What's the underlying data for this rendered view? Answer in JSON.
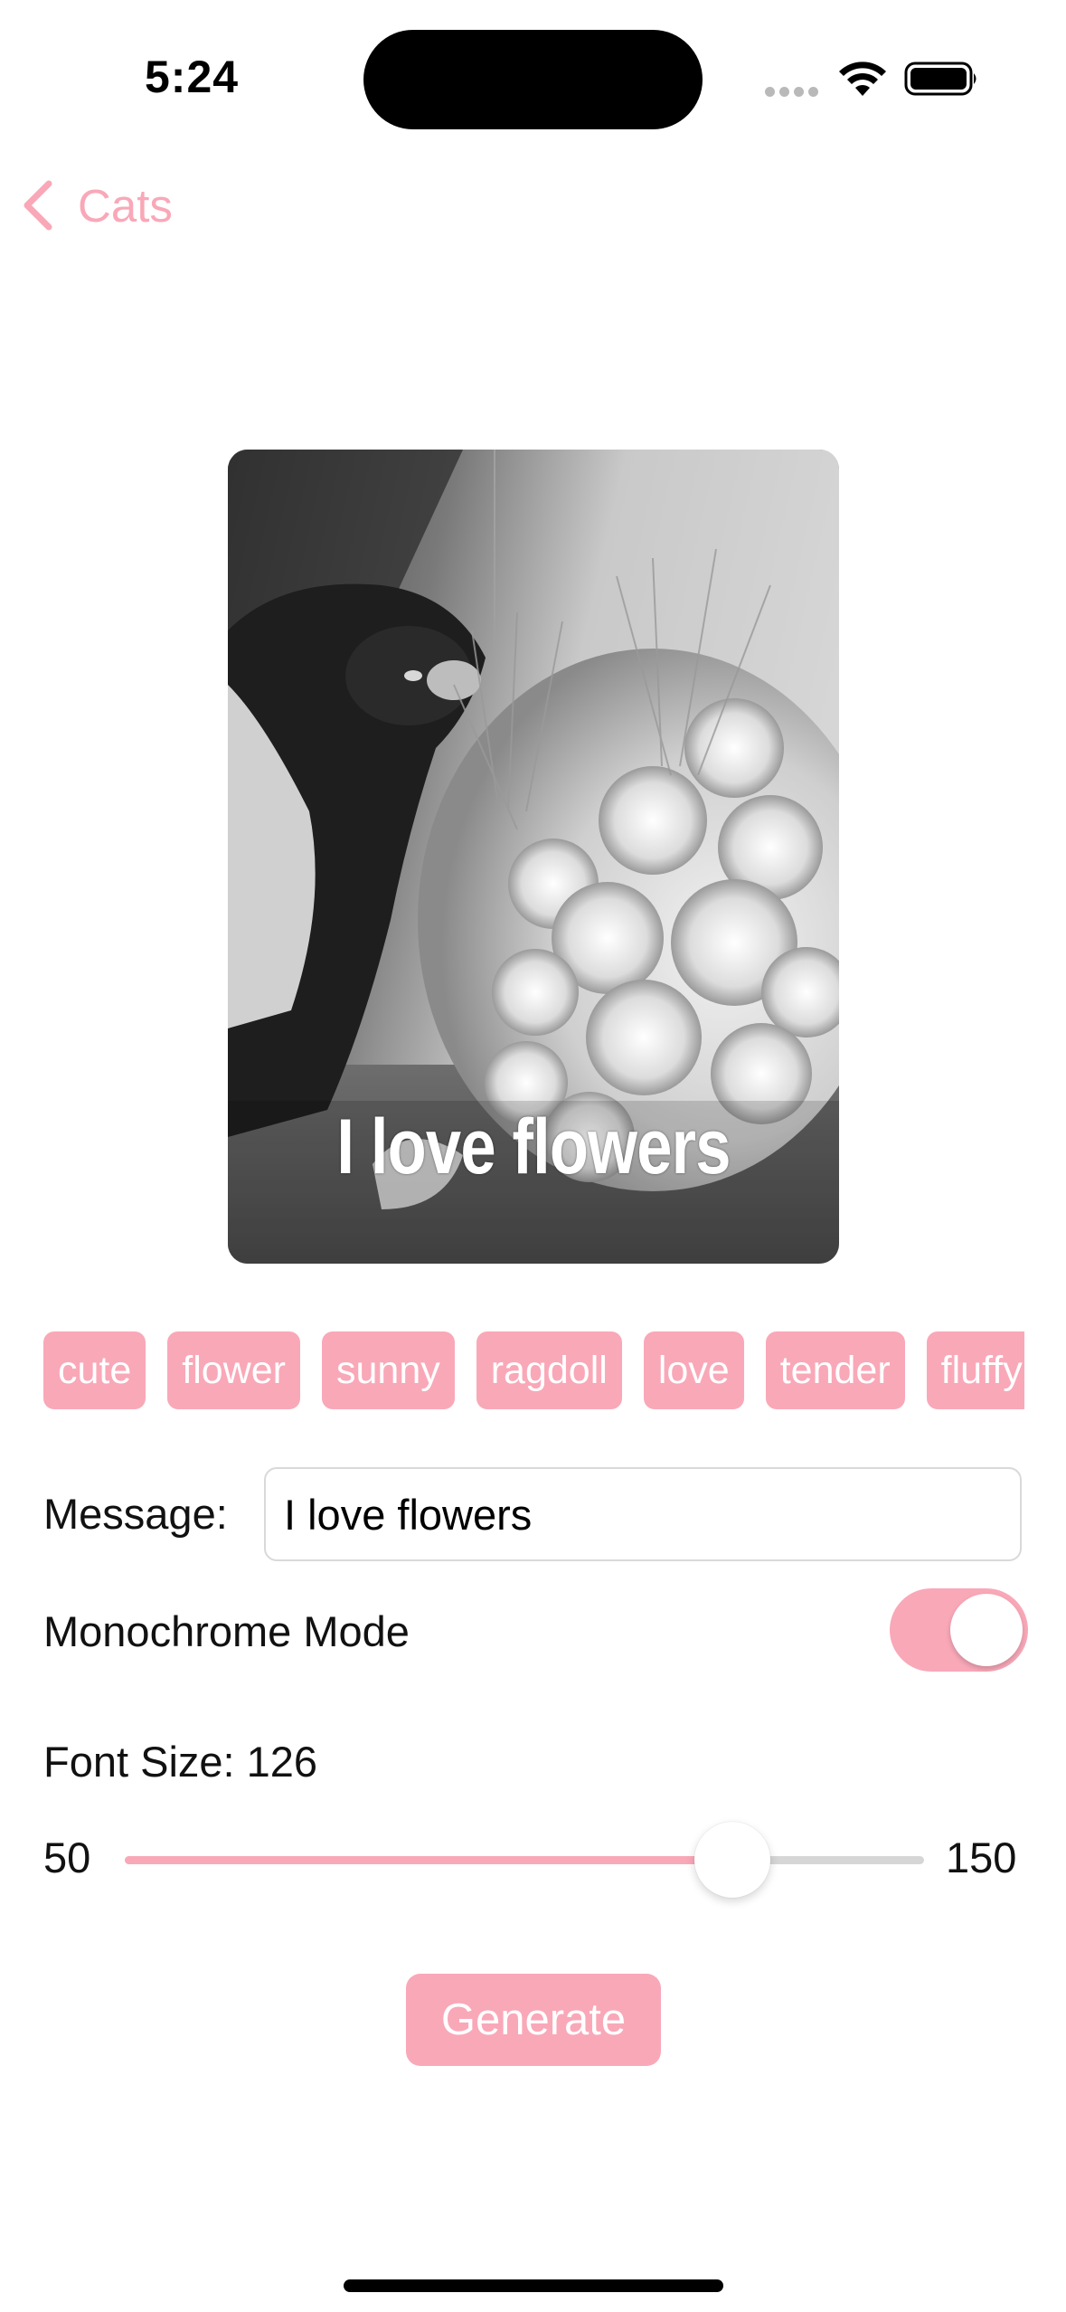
{
  "status_bar": {
    "time": "5:24",
    "icons": [
      "cellular-signal-icon",
      "wifi-icon",
      "battery-icon"
    ]
  },
  "nav": {
    "back_label": "Cats",
    "back_icon": "chevron-left-icon"
  },
  "meme": {
    "caption": "I love flowers",
    "monochrome": true
  },
  "tags": [
    "cute",
    "flower",
    "sunny",
    "ragdoll",
    "love",
    "tender",
    "fluffy"
  ],
  "form": {
    "message_label": "Message:",
    "message_value": "I love flowers",
    "monochrome_label": "Monochrome Mode",
    "monochrome_on": true,
    "font_size_label": "Font Size: 126",
    "font_size_value": 126,
    "slider_min": "50",
    "slider_max": "150",
    "generate_label": "Generate"
  },
  "colors": {
    "accent": "#f9a8b8",
    "background": "#ffffff",
    "track_inactive": "#d6d6d6"
  }
}
